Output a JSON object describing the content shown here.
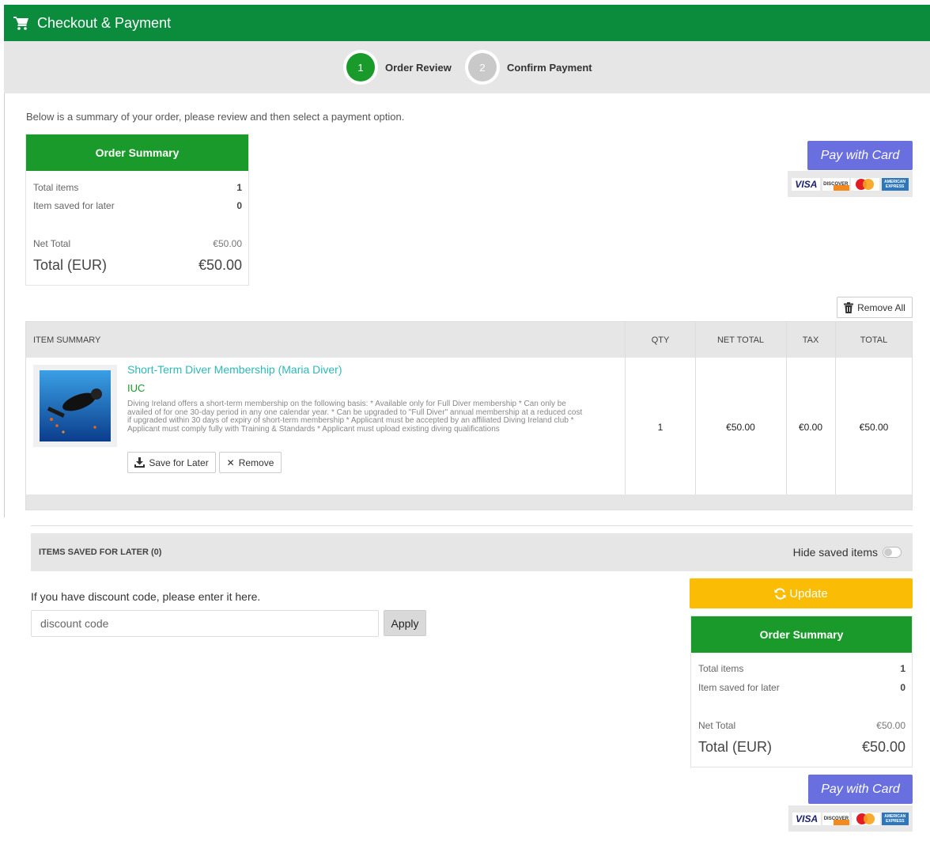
{
  "header": {
    "title": "Checkout & Payment"
  },
  "steps": [
    {
      "number": "1",
      "label": "Order Review",
      "state": "active"
    },
    {
      "number": "2",
      "label": "Confirm Payment",
      "state": "inactive"
    }
  ],
  "intro": "Below is a summary of your order, please review and then select a payment option.",
  "order_summary": {
    "heading": "Order Summary",
    "total_items_label": "Total items",
    "total_items_value": "1",
    "saved_label": "Item saved for later",
    "saved_value": "0",
    "net_total_label": "Net Total",
    "net_total_value": "€50.00",
    "total_label": "Total (EUR)",
    "total_value": "€50.00"
  },
  "pay_button": "Pay with Card",
  "card_logos": {
    "visa": "VISA",
    "discover": "DISCOVER",
    "mastercard": "MasterCard",
    "amex": "AMERICAN EXPRESS"
  },
  "remove_all": "Remove All",
  "table": {
    "headers": [
      "ITEM SUMMARY",
      "QTY",
      "NET TOTAL",
      "TAX",
      "TOTAL"
    ],
    "item": {
      "title": "Short-Term Diver Membership (Maria Diver)",
      "subtitle": "IUC",
      "description": "Diving Ireland offers a short-term membership on the following basis: * Available only for Full Diver membership * Can only be availed of for one 30-day period in any one calendar year. * Can be upgraded to \"Full Diver\" annual membership at a reduced cost if upgraded within 30 days of expiry of short-term membership * Applicant must be accepted by an affiliated Diving Ireland club * Applicant must comply fully with Training & Standards * Applicant must upload existing diving qualifications",
      "save_later": "Save for Later",
      "remove": "Remove",
      "qty": "1",
      "net_total": "€50.00",
      "tax": "€0.00",
      "total": "€50.00"
    }
  },
  "saved_items": {
    "label": "ITEMS SAVED FOR LATER (0)",
    "toggle_label": "Hide saved items",
    "toggle_on": false
  },
  "discount": {
    "label": "If you have discount code, please enter it here.",
    "placeholder": "discount code",
    "apply": "Apply"
  },
  "update_button": "Update",
  "colors": {
    "header_green": "#0b8c3c",
    "summary_green": "#1a9a2a",
    "pay_button": "#6a6fe0",
    "update_button": "#fbbc05",
    "title_link": "#2eb8b8"
  }
}
